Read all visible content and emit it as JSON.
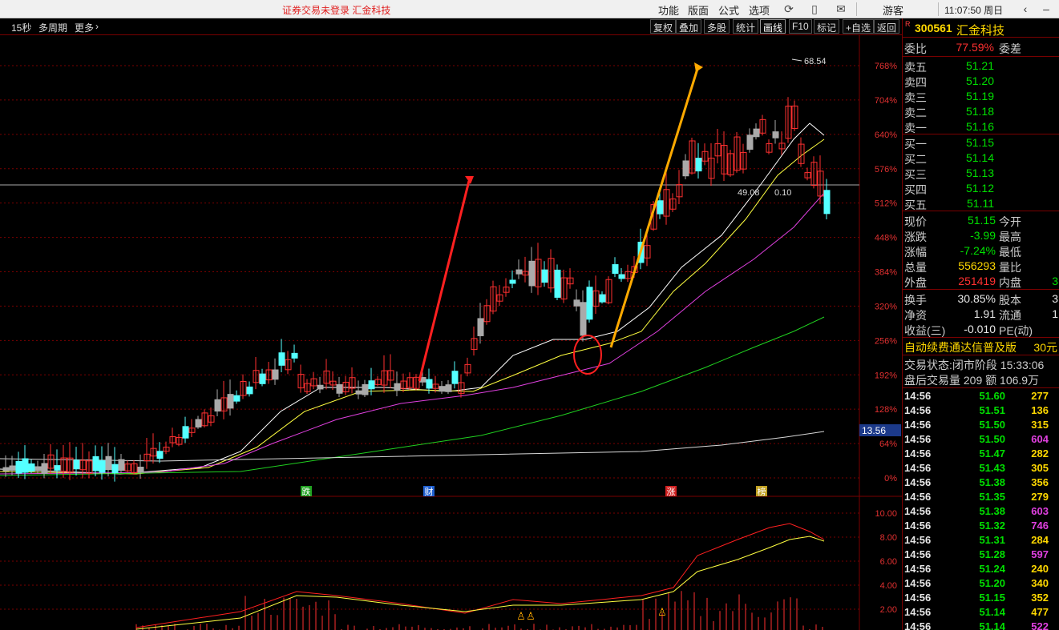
{
  "titlebar": {
    "warning": "证券交易未登录  汇金科技",
    "menus": [
      "功能",
      "版面",
      "公式",
      "选项"
    ],
    "guest": "游客",
    "clock": "11:07:50 周日"
  },
  "toolbar": {
    "left_items": [
      "15秒",
      "多周期",
      "更多"
    ],
    "buttons": [
      "复权",
      "叠加",
      "多股",
      "统计",
      "画线",
      "F10",
      "标记",
      "+自选",
      "返回"
    ],
    "active_button": "画线"
  },
  "chart": {
    "y_labels": [
      "768%",
      "704%",
      "640%",
      "576%",
      "512%",
      "448%",
      "384%",
      "320%",
      "256%",
      "192%",
      "128%",
      "64%",
      "0%"
    ],
    "highlight_label": "13.56",
    "peak_label": "68.54",
    "low_label": "49.08",
    "mid_overlay": "0.10",
    "event_markers": [
      "跌",
      "财",
      "涨",
      "榜"
    ],
    "sub_y_labels": [
      "10.00",
      "8.00",
      "6.00",
      "4.00",
      "2.00"
    ]
  },
  "chart_data": {
    "type": "candlestick",
    "y_axis": "percent change",
    "ylim": [
      0,
      800
    ],
    "price_overlay_line": 13.56,
    "annotations": [
      "68.54",
      "49.08"
    ]
  },
  "panel": {
    "code": "300561",
    "name": "汇金科技",
    "weibi_label": "委比",
    "weibi_value": "77.59%",
    "weicha_label": "委差",
    "asks": [
      {
        "label": "卖五",
        "price": "51.21"
      },
      {
        "label": "卖四",
        "price": "51.20"
      },
      {
        "label": "卖三",
        "price": "51.19"
      },
      {
        "label": "卖二",
        "price": "51.18"
      },
      {
        "label": "卖一",
        "price": "51.16"
      }
    ],
    "bids": [
      {
        "label": "买一",
        "price": "51.15"
      },
      {
        "label": "买二",
        "price": "51.14"
      },
      {
        "label": "买三",
        "price": "51.13"
      },
      {
        "label": "买四",
        "price": "51.12"
      },
      {
        "label": "买五",
        "price": "51.11"
      }
    ],
    "stats": [
      {
        "l1": "现价",
        "v1": "51.15",
        "c1": "green",
        "l2": "今开",
        "v2": ""
      },
      {
        "l1": "涨跌",
        "v1": "-3.99",
        "c1": "green",
        "l2": "最高",
        "v2": ""
      },
      {
        "l1": "涨幅",
        "v1": "-7.24%",
        "c1": "green",
        "l2": "最低",
        "v2": ""
      },
      {
        "l1": "总量",
        "v1": "556293",
        "c1": "yellow",
        "l2": "量比",
        "v2": ""
      },
      {
        "l1": "外盘",
        "v1": "251419",
        "c1": "red",
        "l2": "内盘",
        "v2": "3"
      }
    ],
    "stats2": [
      {
        "l1": "换手",
        "v1": "30.85%",
        "l2": "股本",
        "v2": "3"
      },
      {
        "l1": "净资",
        "v1": "1.91",
        "l2": "流通",
        "v2": "1"
      },
      {
        "l1": "收益(三)",
        "v1": "-0.010",
        "l2": "PE(动)",
        "v2": ""
      }
    ],
    "ad_text": "自动续费通达信普及版",
    "ad_price": "30元",
    "status_text": "交易状态:闭市阶段 15:33:06",
    "after_text": "盘后交易量 209 额 106.9万",
    "ticks": [
      {
        "t": "14:56",
        "p": "51.60",
        "v": "277",
        "vc": "yellow"
      },
      {
        "t": "14:56",
        "p": "51.51",
        "v": "136",
        "vc": "yellow"
      },
      {
        "t": "14:56",
        "p": "51.50",
        "v": "315",
        "vc": "yellow"
      },
      {
        "t": "14:56",
        "p": "51.50",
        "v": "604",
        "vc": "magenta"
      },
      {
        "t": "14:56",
        "p": "51.47",
        "v": "282",
        "vc": "yellow"
      },
      {
        "t": "14:56",
        "p": "51.43",
        "v": "305",
        "vc": "yellow"
      },
      {
        "t": "14:56",
        "p": "51.38",
        "v": "356",
        "vc": "yellow"
      },
      {
        "t": "14:56",
        "p": "51.35",
        "v": "279",
        "vc": "yellow"
      },
      {
        "t": "14:56",
        "p": "51.38",
        "v": "603",
        "vc": "magenta"
      },
      {
        "t": "14:56",
        "p": "51.32",
        "v": "746",
        "vc": "magenta"
      },
      {
        "t": "14:56",
        "p": "51.31",
        "v": "284",
        "vc": "yellow"
      },
      {
        "t": "14:56",
        "p": "51.28",
        "v": "597",
        "vc": "magenta"
      },
      {
        "t": "14:56",
        "p": "51.24",
        "v": "240",
        "vc": "yellow"
      },
      {
        "t": "14:56",
        "p": "51.20",
        "v": "340",
        "vc": "yellow"
      },
      {
        "t": "14:56",
        "p": "51.15",
        "v": "352",
        "vc": "yellow"
      },
      {
        "t": "14:56",
        "p": "51.14",
        "v": "477",
        "vc": "yellow"
      },
      {
        "t": "14:56",
        "p": "51.14",
        "v": "522",
        "vc": "magenta"
      }
    ]
  }
}
